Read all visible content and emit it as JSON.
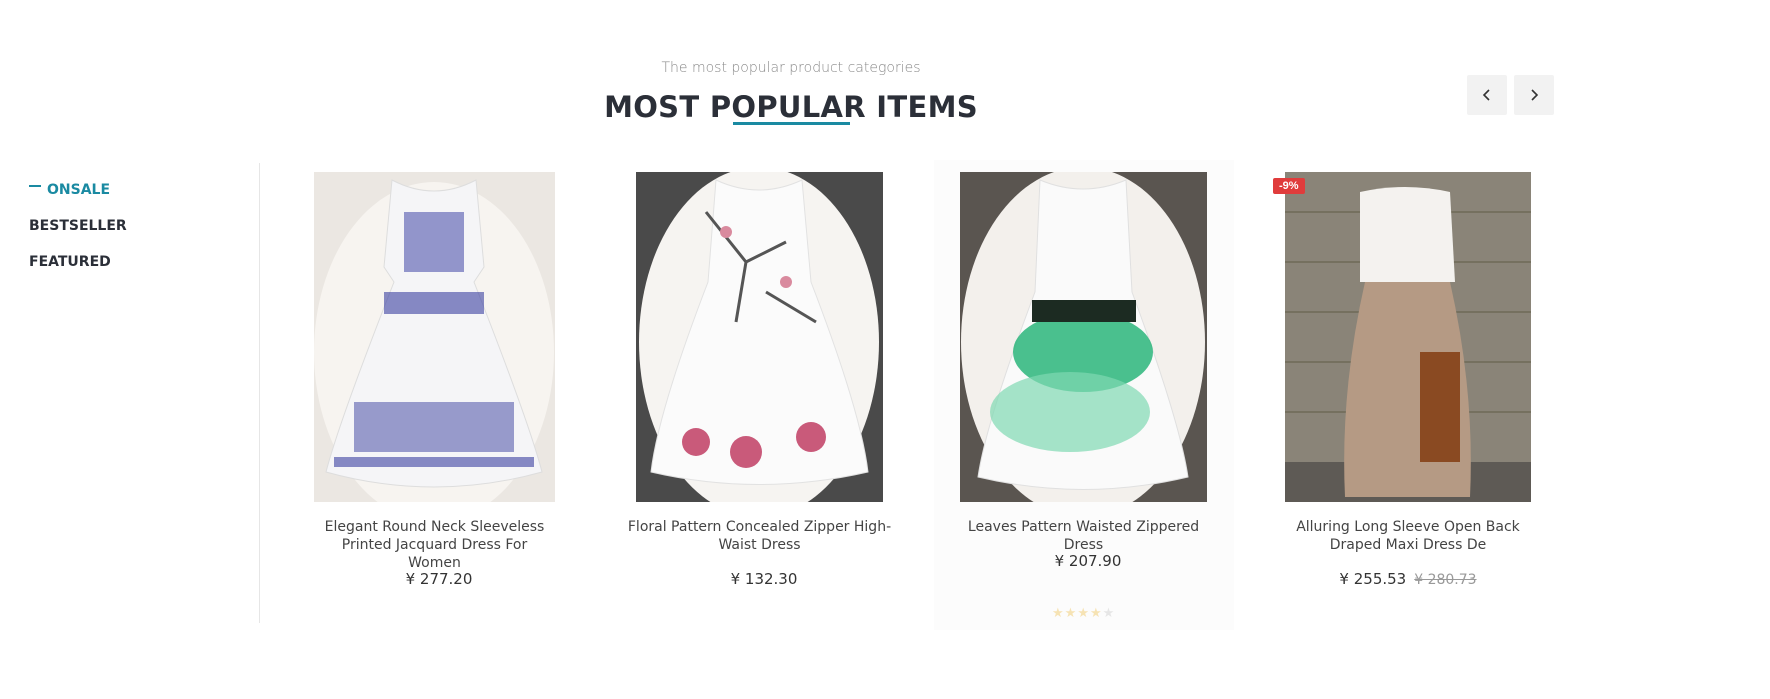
{
  "header": {
    "subtitle": "The most popular product categories",
    "title": "MOST POPULAR ITEMS",
    "prev_icon": "chevron-left-icon",
    "next_icon": "chevron-right-icon"
  },
  "tabs": [
    {
      "label": "ONSALE",
      "active": true
    },
    {
      "label": "BESTSELLER",
      "active": false
    },
    {
      "label": "FEATURED",
      "active": false
    }
  ],
  "products": [
    {
      "name": "Elegant Round Neck Sleeveless Printed Jacquard Dress For Women",
      "price": "¥ 277.20"
    },
    {
      "name": "Floral Pattern Concealed Zipper High-Waist Dress",
      "price": "¥ 132.30"
    },
    {
      "name": "Leaves Pattern Waisted Zippered Dress",
      "price": "¥ 207.90",
      "rating": 4
    },
    {
      "name": "Alluring Long Sleeve Open Back Draped Maxi Dress De",
      "price": "¥ 255.53",
      "old_price": "¥ 280.73",
      "badge": "-9%"
    }
  ],
  "colors": {
    "accent": "#1a8aa2",
    "badge": "#e03c3c"
  }
}
